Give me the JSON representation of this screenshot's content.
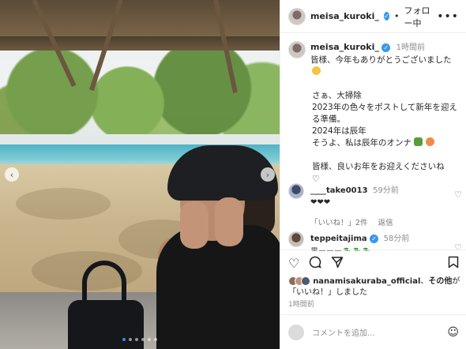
{
  "post": {
    "username": "meisa_kuroki_",
    "follow_separator": "•",
    "follow_status": "フォロー中",
    "more_label": "•••"
  },
  "caption": {
    "username": "meisa_kuroki_",
    "time": "1時間前",
    "lines": [
      "皆様、今年もありがとうございました",
      "",
      "",
      "さぁ、大掃除",
      "2023年の色々をポストして新年を迎え",
      "る準備。",
      "2024年は辰年",
      "そうよ、私は辰年のオンナ",
      "",
      "皆様、良いお年をお迎えくださいね"
    ],
    "emoji_colors": [
      "#f5c542",
      "#5a9b3c",
      "#f08a4b"
    ]
  },
  "comments": [
    {
      "username": "____take0013",
      "time": "59分前",
      "text": "❤❤❤",
      "likes": "「いいね！」2件",
      "reply": "返信"
    },
    {
      "username": "teppeitajima",
      "time": "58分前",
      "text": "黒ーーー🐉🐉🐉"
    }
  ],
  "actions": {
    "like_icon": "heart-icon",
    "comment_icon": "comment-icon",
    "share_icon": "share-icon",
    "save_icon": "bookmark-icon"
  },
  "likes": {
    "user": "nanamisakuraba_official",
    "connector": "、",
    "others": "その他",
    "suffix": "が",
    "line2": "「いいね！」しました"
  },
  "posted_time": "1時間前",
  "comment_input": {
    "placeholder": "コメントを追加..."
  },
  "colors": {
    "verified": "#3897f0",
    "carousel_active": "#3a8bf0"
  }
}
